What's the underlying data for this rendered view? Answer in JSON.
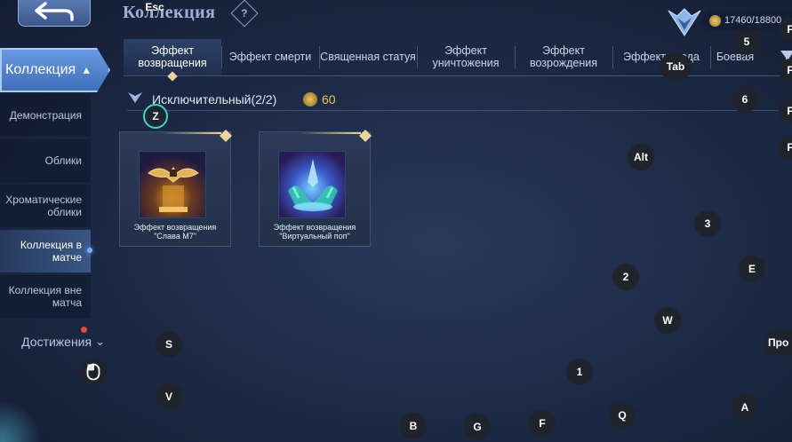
{
  "header": {
    "title": "Коллекция",
    "help_symbol": "?",
    "currency": "17460/18800",
    "back_key": "Esc"
  },
  "sidebar": {
    "head": {
      "label": "Коллекция",
      "caret": "▲"
    },
    "items": [
      {
        "label": "Демонстрация"
      },
      {
        "label": "Облики"
      },
      {
        "label": "Хроматические облики"
      },
      {
        "label": "Коллекция в матче",
        "active": true
      },
      {
        "label": "Коллекция вне матча"
      }
    ],
    "achievements": {
      "label": "Достижения",
      "caret": "⌄"
    }
  },
  "tabs": [
    {
      "label": "Эффект возвращения",
      "active": true
    },
    {
      "label": "Эффект смерти"
    },
    {
      "label": "Священная статуя"
    },
    {
      "label": "Эффект уничтожения"
    },
    {
      "label": "Эффект возрождения"
    },
    {
      "label": "Эффект следа"
    },
    {
      "label": "Боевая"
    }
  ],
  "section": {
    "title": "Исключительный(2/2)",
    "count": "60"
  },
  "cards": [
    {
      "caption_line1": "Эффект возвращения",
      "caption_line2": "\"Слава M7\"",
      "accent": "#e0a43a"
    },
    {
      "caption_line1": "Эффект возвращения",
      "caption_line2": "\"Виртуальный поп\"",
      "accent": "#5ab8f0"
    }
  ],
  "keys": {
    "esc": "Esc",
    "tab": "Tab",
    "k5": "5",
    "k6": "6",
    "z": "Z",
    "alt": "Alt",
    "k3": "3",
    "k2": "2",
    "e": "E",
    "w": "W",
    "s": "S",
    "v": "V",
    "k1": "1",
    "b": "B",
    "g": "G",
    "f": "F",
    "q": "Q",
    "a": "A",
    "f1": "F",
    "f2": "F",
    "f3": "F",
    "f4": "F",
    "pro": "Про"
  },
  "colors": {
    "accent": "#a9cbff",
    "gold": "#e9c46a",
    "teal": "#3fd3c0"
  }
}
